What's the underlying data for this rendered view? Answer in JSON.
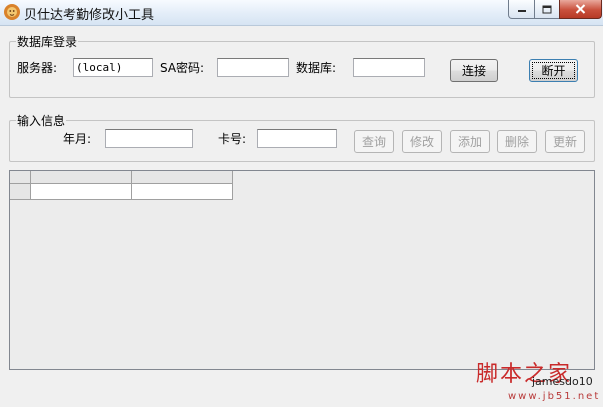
{
  "window": {
    "title": "贝仕达考勤修改小工具",
    "icon": "lion-app-icon"
  },
  "db_group": {
    "title": "数据库登录",
    "server_label": "服务器:",
    "server_value": "(local)",
    "sa_password_label": "SA密码:",
    "sa_password_value": "",
    "database_label": "数据库:",
    "database_value": "",
    "connect_label": "连接",
    "disconnect_label": "断开"
  },
  "input_group": {
    "title": "输入信息",
    "month_label": "年月:",
    "month_value": "",
    "card_label": "卡号:",
    "card_value": "",
    "query_label": "查询",
    "modify_label": "修改",
    "add_label": "添加",
    "delete_label": "删除",
    "update_label": "更新"
  },
  "watermark": {
    "site": "脚本之家",
    "user": "jamesdo10",
    "url": "www.jb51.net"
  },
  "colors": {
    "window_bg": "#f0f0f0",
    "watermark": "#c92a2a"
  }
}
